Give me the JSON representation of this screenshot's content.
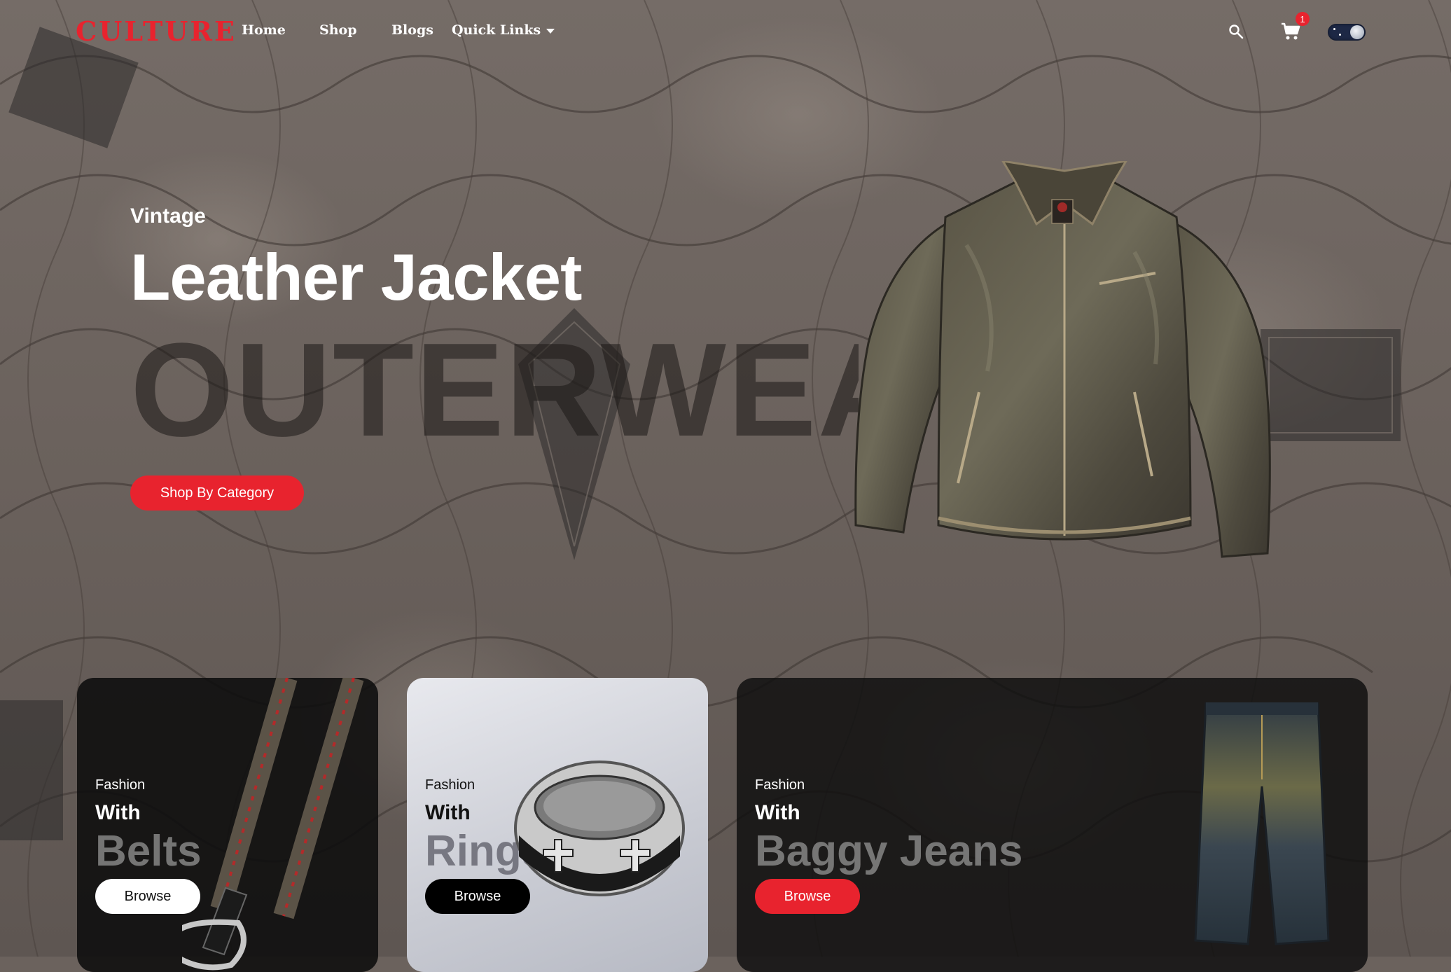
{
  "nav": {
    "logo": "CULTURE",
    "links": [
      "Home",
      "Shop",
      "Blogs",
      "Quick Links"
    ],
    "cart_count": "1"
  },
  "hero": {
    "eyebrow": "Vintage",
    "title": "Leather Jacket",
    "ghost": "OUTERWEAR",
    "cta": "Shop By Category"
  },
  "cards": [
    {
      "eyebrow": "Fashion",
      "with": "With",
      "name": "Belts",
      "button": "Browse"
    },
    {
      "eyebrow": "Fashion",
      "with": "With",
      "name": "Rings",
      "button": "Browse"
    },
    {
      "eyebrow": "Fashion",
      "with": "With",
      "name": "Baggy Jeans",
      "button": "Browse"
    }
  ],
  "colors": {
    "accent": "#e8232e",
    "nav_text": "#ffffff",
    "dark_card": "#0c0c0c",
    "light_card": "#d6d8de"
  },
  "icons": [
    "search-icon",
    "cart-icon",
    "theme-toggle"
  ]
}
